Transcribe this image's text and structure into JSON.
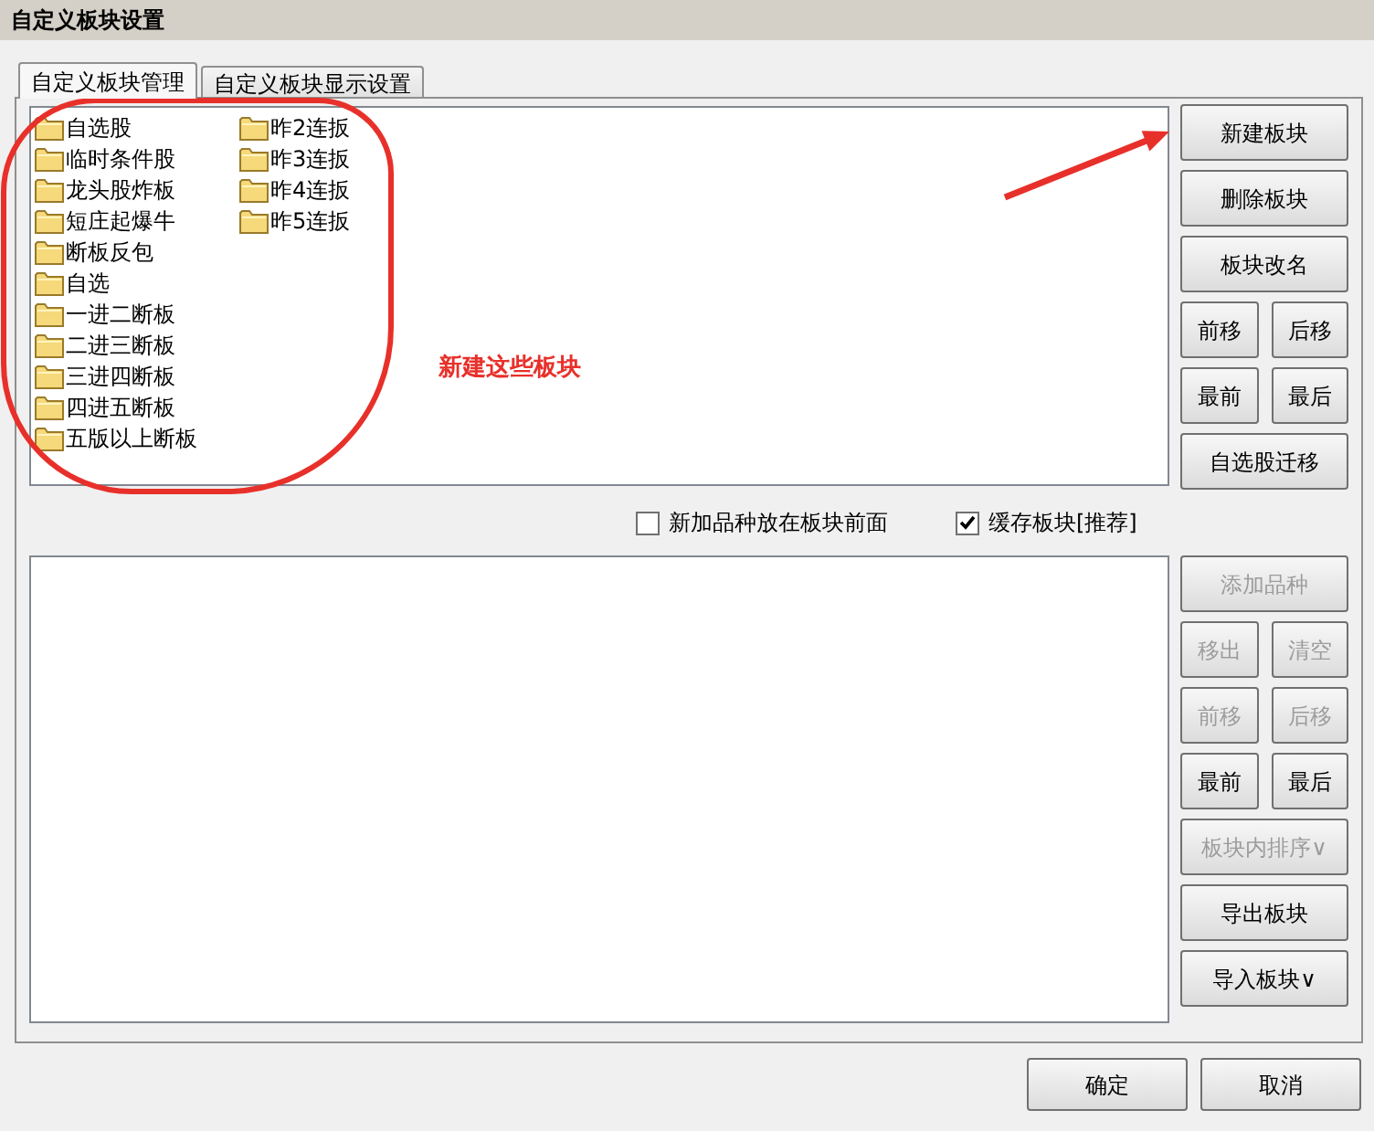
{
  "window": {
    "title": "自定义板块设置"
  },
  "tabs": [
    {
      "label": "自定义板块管理",
      "selected": true
    },
    {
      "label": "自定义板块显示设置",
      "selected": false
    }
  ],
  "block_list": {
    "items": [
      {
        "label": "自选股"
      },
      {
        "label": "临时条件股"
      },
      {
        "label": "龙头股炸板"
      },
      {
        "label": "短庄起爆牛"
      },
      {
        "label": "断板反包"
      },
      {
        "label": "自选"
      },
      {
        "label": "一进二断板"
      },
      {
        "label": "二进三断板"
      },
      {
        "label": "三进四断板"
      },
      {
        "label": "四进五断板"
      },
      {
        "label": "五版以上断板"
      },
      {
        "label": "昨2连扳"
      },
      {
        "label": "昨3连扳"
      },
      {
        "label": "昨4连扳"
      },
      {
        "label": "昨5连扳"
      }
    ]
  },
  "annotation": {
    "text": "新建这些板块"
  },
  "block_buttons": [
    {
      "buttons": [
        {
          "label": "新建板块",
          "disabled": false
        }
      ]
    },
    {
      "buttons": [
        {
          "label": "删除板块",
          "disabled": false
        }
      ]
    },
    {
      "buttons": [
        {
          "label": "板块改名",
          "disabled": false
        }
      ]
    },
    {
      "buttons": [
        {
          "label": "前移",
          "disabled": false
        },
        {
          "label": "后移",
          "disabled": false
        }
      ]
    },
    {
      "buttons": [
        {
          "label": "最前",
          "disabled": false
        },
        {
          "label": "最后",
          "disabled": false
        }
      ]
    },
    {
      "buttons": [
        {
          "label": "自选股迁移",
          "disabled": false
        }
      ]
    }
  ],
  "options": [
    {
      "label": "新加品种放在板块前面",
      "checked": false
    },
    {
      "label": "缓存板块[推荐]",
      "checked": true
    }
  ],
  "stock_buttons": [
    {
      "buttons": [
        {
          "label": "添加品种",
          "disabled": true
        }
      ]
    },
    {
      "buttons": [
        {
          "label": "移出",
          "disabled": true
        },
        {
          "label": "清空",
          "disabled": true
        }
      ]
    },
    {
      "buttons": [
        {
          "label": "前移",
          "disabled": true
        },
        {
          "label": "后移",
          "disabled": true
        }
      ]
    },
    {
      "buttons": [
        {
          "label": "最前",
          "disabled": false
        },
        {
          "label": "最后",
          "disabled": false
        }
      ]
    },
    {
      "buttons": [
        {
          "label": "板块内排序∨",
          "disabled": true
        }
      ]
    },
    {
      "buttons": [
        {
          "label": "导出板块",
          "disabled": false
        }
      ]
    },
    {
      "buttons": [
        {
          "label": "导入板块∨",
          "disabled": false
        }
      ]
    }
  ],
  "dialog_buttons": [
    {
      "label": "确定"
    },
    {
      "label": "取消"
    }
  ]
}
